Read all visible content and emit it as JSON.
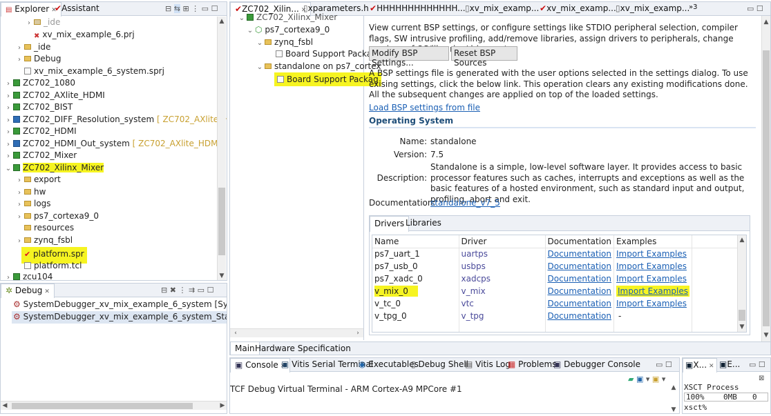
{
  "explorer": {
    "tab_explorer": "Explorer",
    "tab_assistant": "Assistant",
    "tree": [
      {
        "label": "_ide",
        "icon": "folder-gray-icon"
      },
      {
        "label": "xv_mix_example_6.prj",
        "icon": "prj-file-icon"
      },
      {
        "label": "_ide",
        "icon": "folder-icon"
      },
      {
        "label": "Debug",
        "icon": "folder-icon"
      },
      {
        "label": "xv_mix_example_6_system.sprj",
        "icon": "sprj-file-icon"
      },
      {
        "label": "ZC702_1080",
        "icon": "project-icon"
      },
      {
        "label": "ZC702_AXlite_HDMI",
        "icon": "project-icon"
      },
      {
        "label": "ZC702_BIST",
        "icon": "project-icon"
      },
      {
        "label": "ZC702_DIFF_Resolution_system",
        "suffix": "[ ZC702_AXlite_HDMI ]",
        "icon": "system-project-icon"
      },
      {
        "label": "ZC702_HDMI",
        "icon": "project-icon"
      },
      {
        "label": "ZC702_HDMI_Out_system",
        "suffix": "[ ZC702_AXlite_HDMI ]",
        "icon": "system-project-icon"
      },
      {
        "label": "ZC702_Mixer",
        "icon": "project-icon"
      },
      {
        "label": "ZC702_Xilinx_Mixer",
        "icon": "project-icon"
      },
      {
        "label": "export",
        "icon": "folder-icon"
      },
      {
        "label": "hw",
        "icon": "folder-icon"
      },
      {
        "label": "logs",
        "icon": "folder-icon"
      },
      {
        "label": "ps7_cortexa9_0",
        "icon": "folder-icon"
      },
      {
        "label": "resources",
        "icon": "folder-icon"
      },
      {
        "label": "zynq_fsbl",
        "icon": "folder-icon"
      },
      {
        "label": "platform.spr",
        "icon": "spr-file-icon"
      },
      {
        "label": "platform.tcl",
        "icon": "tcl-file-icon"
      },
      {
        "label": "zcu104",
        "icon": "project-icon"
      }
    ]
  },
  "debug": {
    "tab": "Debug",
    "items": [
      "SystemDebugger_xv_mix_example_6_system [System Project",
      "SystemDebugger_xv_mix_example_6_system_Standalone (Lo"
    ]
  },
  "editor": {
    "tabs": [
      "ZC702_Xilin...",
      "xparameters.h",
      "HHHHHHHHHHHHH...",
      "xv_mix_examp...",
      "xv_mix_examp...",
      "xv_mix_examp...",
      "»3"
    ],
    "outline": {
      "items": [
        "ZC702_Xilinx_Mixer",
        "ps7_cortexa9_0",
        "zynq_fsbl",
        "Board Support Packag",
        "standalone on ps7_cortex",
        "Board Support Packag"
      ]
    },
    "intro": "View current BSP settings, or configure settings like STDIO peripheral selection, compiler flags, SW intrusive profiling, add/remove libraries, assign drivers to peripherals, change versions of OS/libraries/drivers etc.",
    "modify_btn": "Modify BSP Settings...",
    "reset_btn": "Reset BSP Sources",
    "settings_text": "A BSP settings file is generated with the user options selected in the settings dialog. To use exising settings, click the below link. This operation clears any existing modifications done. All the subsequent changes are applied on top of the loaded settings.",
    "load_link": "Load BSP settings from file",
    "os_title": "Operating System",
    "os": {
      "name_label": "Name:",
      "name": "standalone",
      "version_label": "Version:",
      "version": "7.5",
      "description_label": "Description:",
      "description": "Standalone is a simple, low-level software layer. It provides access to basic processor features such as caches, interrupts and exceptions as well as the basic features of a hosted environment, such as standard input and output, profiling, abort and exit.",
      "documentation_label": "Documentation:",
      "documentation": "standalone_v7_5"
    },
    "drivers_tab": "Drivers",
    "libraries_tab": "Libraries",
    "table": {
      "headers": [
        "Name",
        "Driver",
        "Documentation",
        "Examples"
      ],
      "rows": [
        [
          "ps7_uart_1",
          "uartps",
          "Documentation",
          "Import Examples"
        ],
        [
          "ps7_usb_0",
          "usbps",
          "Documentation",
          "Import Examples"
        ],
        [
          "ps7_xadc_0",
          "xadcps",
          "Documentation",
          "Import Examples"
        ],
        [
          "v_mix_0",
          "v_mix",
          "Documentation",
          "Import Examples"
        ],
        [
          "v_tc_0",
          "vtc",
          "Documentation",
          "Import Examples"
        ],
        [
          "v_tpg_0",
          "v_tpg",
          "Documentation",
          "-"
        ]
      ]
    },
    "bottom_tabs": [
      "Main",
      "Hardware Specification"
    ]
  },
  "console": {
    "tabs": [
      "Console",
      "Vitis Serial Terminal",
      "Executables",
      "Debug Shell",
      "Vitis Log",
      "Problems",
      "Debugger Console"
    ],
    "line": "TCF Debug Virtual Terminal - ARM Cortex-A9 MPCore #1"
  },
  "xsct": {
    "tabs": [
      "X...",
      "E..."
    ],
    "process": "XSCT Process",
    "cpu": "100%",
    "mem": "0MB",
    "n": "0",
    "prompt": "xsct%"
  },
  "colors": {
    "highlight": "#f6f421",
    "link": "#1a5fb4",
    "section": "#1f4e79"
  }
}
